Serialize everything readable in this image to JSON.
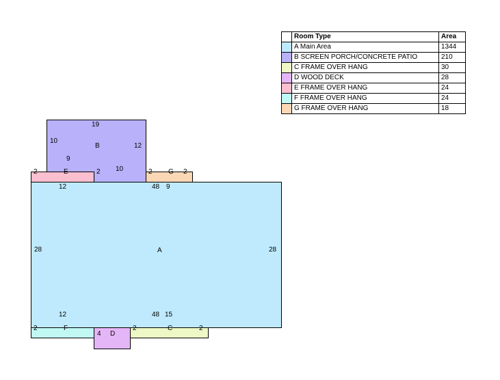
{
  "legend": {
    "headers": {
      "type": "Room Type",
      "area": "Area"
    },
    "rows": [
      {
        "key": "A",
        "name": "A Main Area",
        "area": "1344",
        "color": "#bfeafd"
      },
      {
        "key": "B",
        "name": "B SCREEN PORCH/CONCRETE PATIO",
        "area": "210",
        "color": "#b9b1f9"
      },
      {
        "key": "C",
        "name": "C FRAME OVER HANG",
        "area": "30",
        "color": "#eef8c6"
      },
      {
        "key": "D",
        "name": "D WOOD DECK",
        "area": "28",
        "color": "#e5b6f7"
      },
      {
        "key": "E",
        "name": "E FRAME OVER HANG",
        "area": "24",
        "color": "#fbbfd0"
      },
      {
        "key": "F",
        "name": "F FRAME OVER HANG",
        "area": "24",
        "color": "#c1f8f4"
      },
      {
        "key": "G",
        "name": "G FRAME OVER HANG",
        "area": "18",
        "color": "#fad7b5"
      }
    ]
  },
  "rooms": {
    "A": {
      "letter": "A",
      "color": "#bfeafd",
      "dims": [
        "28",
        "28",
        "12",
        "48",
        "9",
        "12",
        "48",
        "15"
      ]
    },
    "B": {
      "letter": "B",
      "color": "#b9b1f9",
      "dims": [
        "19",
        "10",
        "12",
        "9",
        "2",
        "10"
      ]
    },
    "C": {
      "letter": "C",
      "color": "#eef8c6",
      "dims": [
        "2",
        "2"
      ]
    },
    "D": {
      "letter": "D",
      "color": "#e5b6f7",
      "dims": [
        "4"
      ]
    },
    "E": {
      "letter": "E",
      "color": "#fbbfd0",
      "dims": [
        "2"
      ]
    },
    "F": {
      "letter": "F",
      "color": "#c1f8f4",
      "dims": [
        "2"
      ]
    },
    "G": {
      "letter": "G",
      "color": "#fad7b5",
      "dims": [
        "2",
        "2"
      ]
    }
  }
}
